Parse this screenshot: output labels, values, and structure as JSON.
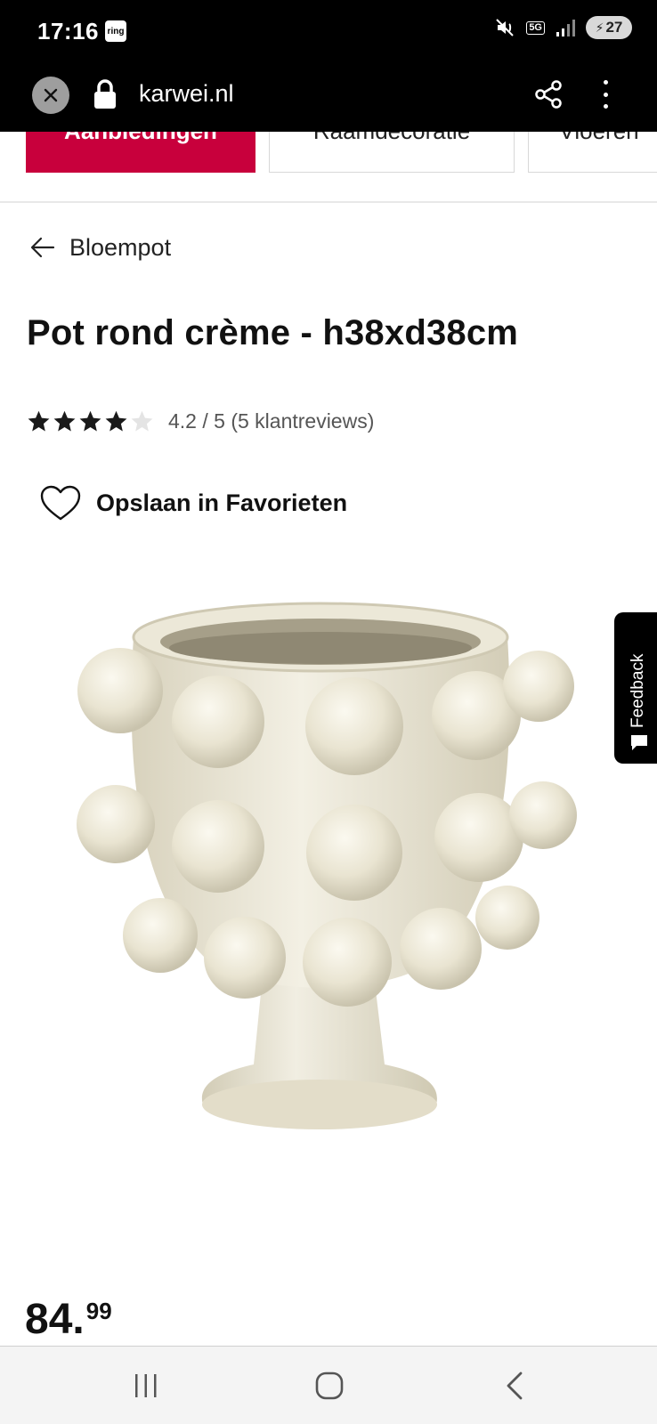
{
  "status_bar": {
    "time": "17:16",
    "ring_badge": "ring",
    "network": "5G",
    "battery": "27"
  },
  "browser": {
    "url": "karwei.nl"
  },
  "category_nav": {
    "items": [
      "Aanbiedingen",
      "Raamdecoratie",
      "Vloeren"
    ]
  },
  "breadcrumb": {
    "label": "Bloempot"
  },
  "product": {
    "title": "Pot rond crème - h38xd38cm",
    "rating_text": "4.2 / 5 (5 klantreviews)",
    "rating_stars_filled": 4,
    "rating_stars_total": 5,
    "favorites_label": "Opslaan in Favorieten",
    "price_integer": "84.",
    "price_decimal": "99"
  },
  "feedback_tab": {
    "label": "Feedback"
  },
  "colors": {
    "accent": "#c8003c",
    "status_bar": "#000000",
    "pot": "#ebe6d3"
  },
  "icons": [
    "close-icon",
    "lock-icon",
    "share-icon",
    "more-icon",
    "arrow-left-icon",
    "star-icon",
    "heart-icon",
    "chat-icon",
    "recents-icon",
    "home-icon",
    "back-icon"
  ]
}
